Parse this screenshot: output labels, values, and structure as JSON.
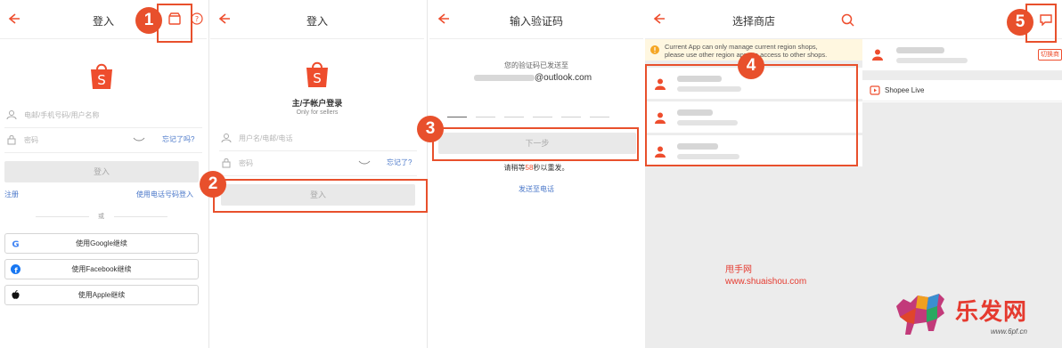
{
  "colors": {
    "brand": "#ee4d2d",
    "callout": "#e8502c",
    "link": "#4a77c9"
  },
  "screen1": {
    "title": "登入",
    "phone_placeholder": "电邮/手机号码/用户名称",
    "password_placeholder": "密码",
    "forgot": "忘记了吗?",
    "login": "登入",
    "register": "注册",
    "phone_login": "使用电话号码登入",
    "or": "或",
    "google": "使用Google继续",
    "facebook": "使用Facebook继续",
    "apple": "使用Apple继续"
  },
  "screen2": {
    "title": "登入",
    "heading": "主/子帐户登录",
    "sub": "Only for sellers",
    "user_placeholder": "用户名/电邮/电话",
    "password_placeholder": "密码",
    "forgot": "忘记了?",
    "login": "登入"
  },
  "screen3": {
    "title": "输入验证码",
    "sent_to": "您的验证码已发送至",
    "email_suffix": "@outlook.com",
    "next": "下一步",
    "wait_prefix": "请稍等",
    "wait_seconds": "58",
    "wait_suffix": "秒以重发。",
    "phone_link": "发送至电话"
  },
  "screen4": {
    "title": "选择商店",
    "notice_line1": "Current App can only manage current region shops,",
    "notice_line2": "please use other region apps to access to other shops."
  },
  "screen5": {
    "switch": "切换商",
    "shopee_live": "Shopee Live"
  },
  "callouts": [
    "1",
    "2",
    "3",
    "4",
    "5"
  ],
  "watermark": {
    "name": "甩手网",
    "url": "www.shuaishou.com"
  },
  "brand": {
    "name": "乐发网",
    "url": "www.6pf.cn"
  },
  "icons": [
    "back-arrow-icon",
    "shop-icon",
    "help-icon",
    "shopee-logo-icon",
    "user-icon",
    "lock-icon",
    "eye-off-icon",
    "google-icon",
    "facebook-icon",
    "apple-icon",
    "warning-icon",
    "search-icon",
    "avatar-icon",
    "live-icon",
    "chat-icon"
  ]
}
